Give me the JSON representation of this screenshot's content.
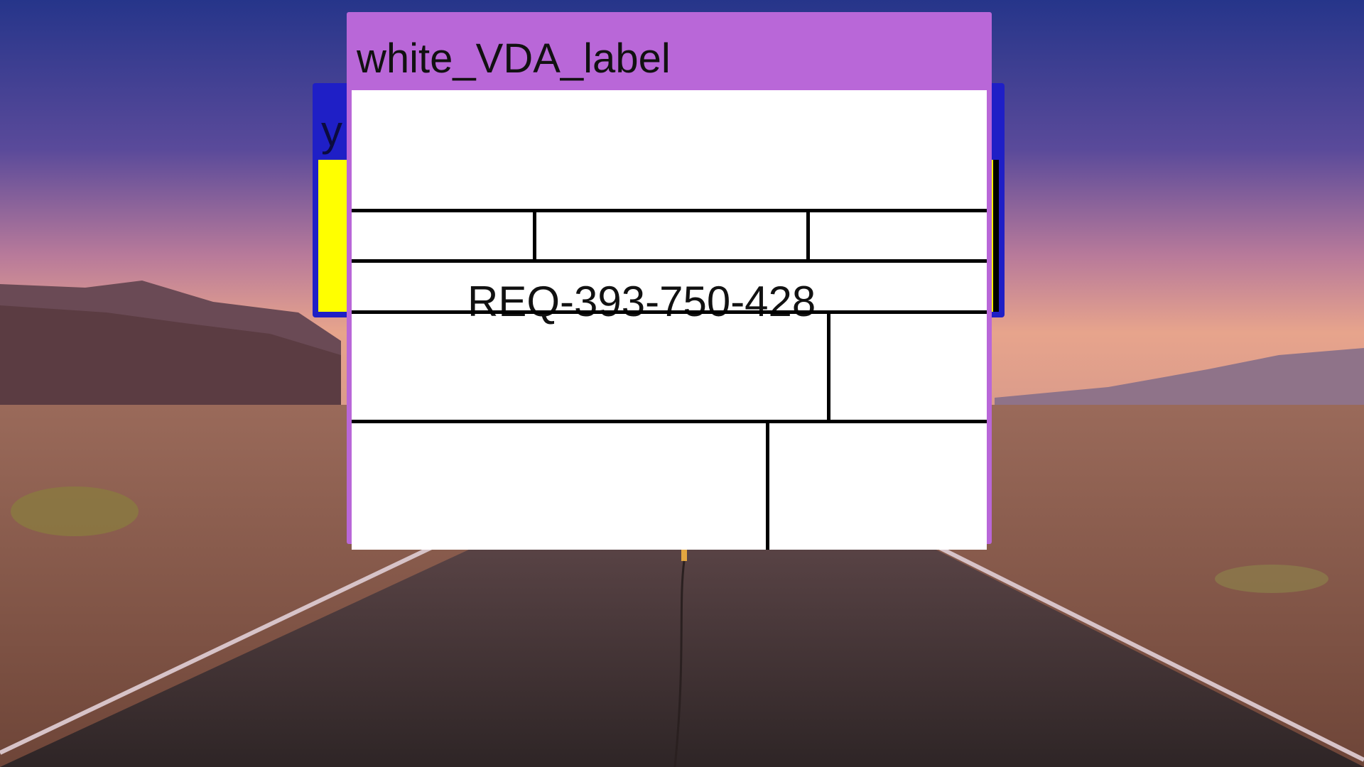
{
  "desktop": {
    "wallpaper_description_colors": {
      "sky_top": "#2c3f8f",
      "sky_mid": "#7b5aa6",
      "horizon": "#e49a86",
      "ground": "#8a5a4a",
      "road": "#3a2e2f"
    }
  },
  "back_window": {
    "title": "y",
    "accent": "#1f1fc6",
    "content_color": "#ffff00"
  },
  "front_window": {
    "title": "white_VDA_label",
    "accent": "#b967d8",
    "request_id": "REQ-393-750-428"
  }
}
